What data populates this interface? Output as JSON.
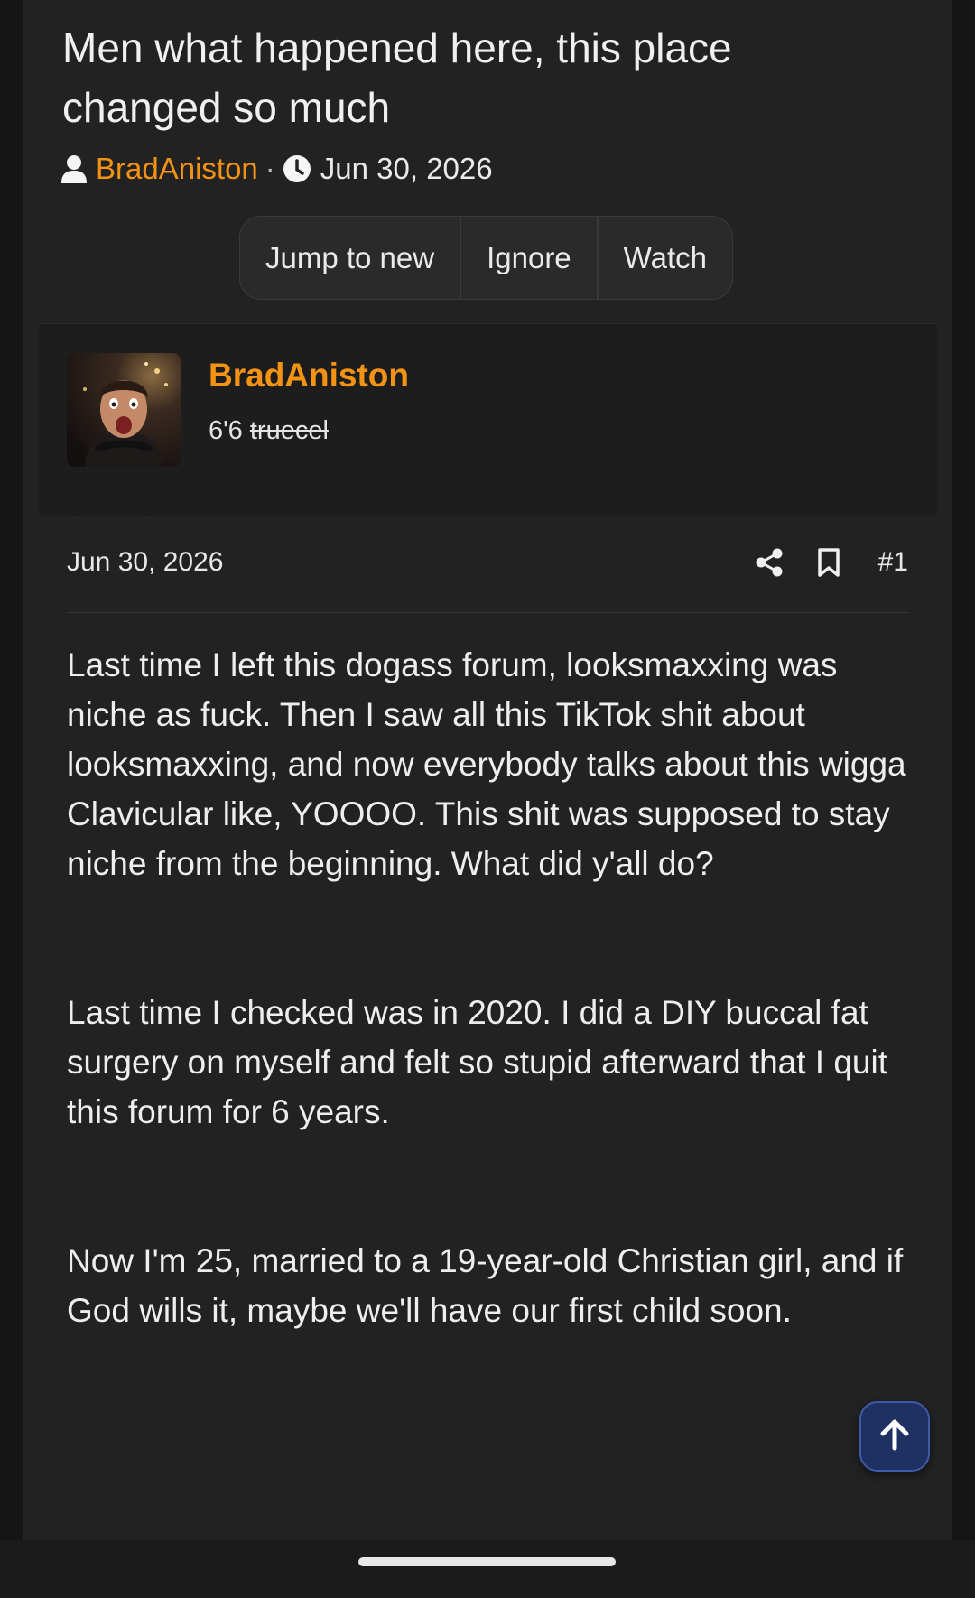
{
  "thread": {
    "title": "Men what happened here, this place changed so much",
    "author": "BradAniston",
    "separator": "·",
    "date": "Jun 30, 2026"
  },
  "actions": {
    "jump_to_new": "Jump to new",
    "ignore": "Ignore",
    "watch": "Watch"
  },
  "post": {
    "username": "BradAniston",
    "user_title_prefix": "6'6",
    "user_title_struck": "truecel",
    "date": "Jun 30, 2026",
    "number": "#1",
    "paragraphs": [
      "Last time I left this dogass forum, looksmaxxing was niche as fuck. Then I saw all this TikTok shit about looksmaxxing, and now everybody talks about this wigga Clavicular like, YOOOO. This shit was supposed to stay niche from the beginning. What did y'all do?",
      "Last time I checked was in 2020. I did a DIY buccal fat surgery on myself and felt so stupid afterward that I quit this forum for 6 years.",
      "Now I'm 25, married to a 19-year-old Christian girl, and if God wills it, maybe we'll have our first child soon."
    ]
  },
  "icons": {
    "user": "user-icon",
    "clock": "clock-icon",
    "share": "share-icon",
    "bookmark": "bookmark-icon",
    "scroll_top": "arrow-up-icon"
  },
  "colors": {
    "accent": "#f39313",
    "background": "#222223",
    "scroll_button": "#1f3163"
  }
}
